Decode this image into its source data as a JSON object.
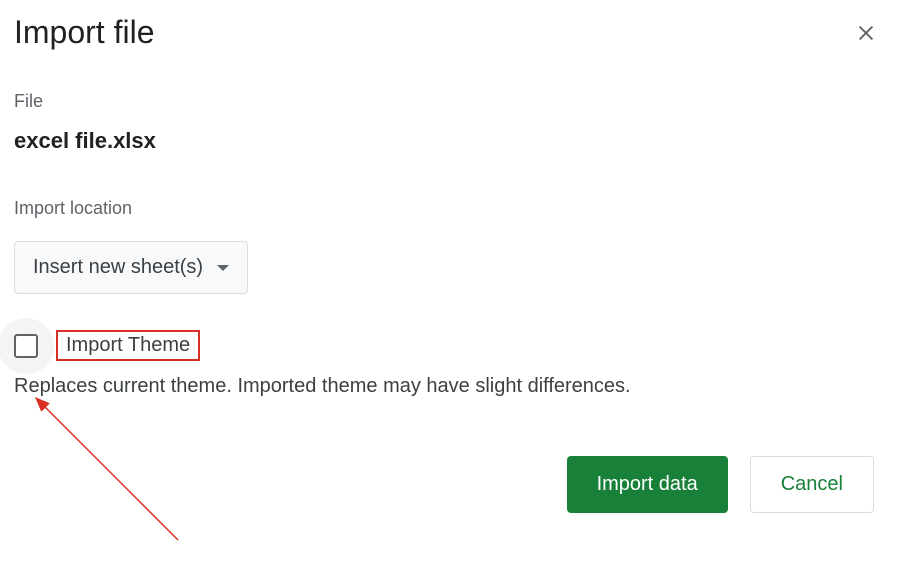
{
  "dialog": {
    "title": "Import file"
  },
  "file": {
    "label": "File",
    "name": "excel file.xlsx"
  },
  "import_location": {
    "label": "Import location",
    "selected": "Insert new sheet(s)"
  },
  "theme": {
    "checkbox_label": "Import Theme",
    "description": "Replaces current theme. Imported theme may have slight differences."
  },
  "buttons": {
    "primary": "Import data",
    "secondary": "Cancel"
  }
}
